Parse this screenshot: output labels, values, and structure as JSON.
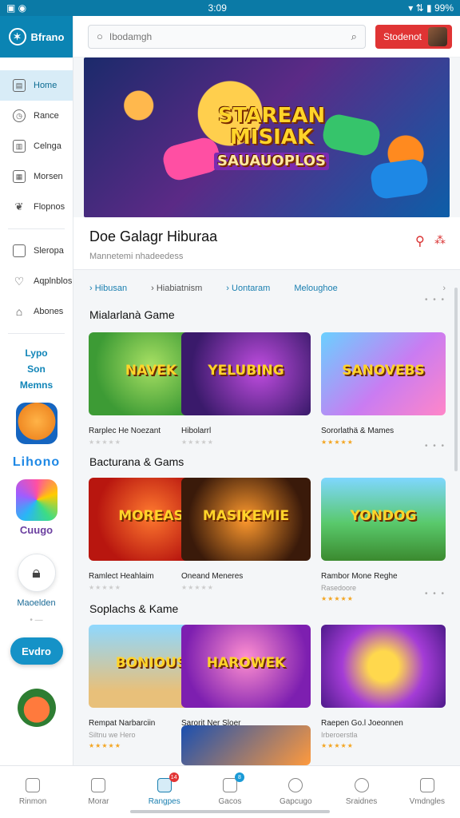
{
  "status": {
    "left_icons": "▣ ◉",
    "time": "3:09",
    "right": "▾ ⇅ ▮ 99%"
  },
  "brand": {
    "name": "Bfrano"
  },
  "sidebar": {
    "items": [
      {
        "label": "Home",
        "icon": "home-icon",
        "active": true
      },
      {
        "label": "Rance",
        "icon": "clock-icon"
      },
      {
        "label": "Celnga",
        "icon": "grid-icon"
      },
      {
        "label": "Morsen",
        "icon": "apps-icon"
      },
      {
        "label": "Flopnos",
        "icon": "leaf-icon"
      },
      {
        "label": "Sleropa",
        "icon": "square-icon"
      },
      {
        "label": "Aqplnblos",
        "icon": "heart-icon"
      },
      {
        "label": "Abones",
        "icon": "home-alt-icon"
      }
    ],
    "promo_lines": [
      "Lypo",
      "Son",
      "Memns"
    ],
    "tile_word": "Lihono",
    "tile_word2": "Cuugo",
    "lock_label": "Maoelden",
    "dots": "• —",
    "cta": "Evdro"
  },
  "search": {
    "placeholder": "Ibodamgh"
  },
  "store_button": {
    "label": "Stodenot"
  },
  "hero": {
    "line1": "STAREAN",
    "line2": "MISIAK",
    "line3": "SAUAUOPLOS",
    "title": "Doe Galagr Hiburaa",
    "subtitle": "Mannetemi nhadeedess"
  },
  "chips": [
    "Hibusan",
    "Hiabiatnism",
    "Uontaram",
    "Meloughoe"
  ],
  "sections": [
    {
      "title": "Mialarlanà Game",
      "dots": "• • •",
      "cards": [
        {
          "name": "Rarplec He Noezant",
          "thumb_word": "NAVEK",
          "stars": "★★★★★",
          "gold": false
        },
        {
          "name": "Hibolarrl",
          "thumb_word": "YELUBING",
          "stars": "★★★★★",
          "gold": false
        },
        {
          "name": "Sororlathä & Mames",
          "thumb_word": "SANOVEBS",
          "stars": "★★★★★",
          "gold": true
        }
      ]
    },
    {
      "title": "Bacturana & Gams",
      "dots": "• • •",
      "cards": [
        {
          "name": "Ramlect Heahlaim",
          "thumb_word": "MOREAS",
          "stars": "★★★★★",
          "gold": false
        },
        {
          "name": "Oneand Meneres",
          "thumb_word": "MASIKEMIE",
          "stars": "★★★★★",
          "gold": false
        },
        {
          "name": "Rambor Mone Reghe",
          "thumb_word": "YONDOG",
          "stars": "★★★★★",
          "gold": true,
          "sub": "Rasedoore"
        }
      ]
    },
    {
      "title": "Soplachs & Kame",
      "dots": "• • •",
      "cards": [
        {
          "name": "Rempat Narbarciin",
          "thumb_word": "BONIOUS",
          "stars": "★★★★★",
          "gold": true,
          "sub": "Siltnu we Hero"
        },
        {
          "name": "Sarorit Ner Sloer",
          "thumb_word": "HAROWEK",
          "stars": "★★★★★",
          "gold": true
        },
        {
          "name": "Raepen Go.l Joeonnen",
          "thumb_word": "",
          "stars": "★★★★★",
          "gold": true,
          "sub": "Irberoerstla"
        }
      ]
    }
  ],
  "bottom_nav": [
    {
      "label": "Rinmon",
      "icon": "home-icon"
    },
    {
      "label": "Morar",
      "icon": "house-icon"
    },
    {
      "label": "Rangpes",
      "icon": "gamepad-icon",
      "badge": "14",
      "active": true
    },
    {
      "label": "Gacos",
      "icon": "inbox-icon",
      "badge": "8"
    },
    {
      "label": "Gapcugo",
      "icon": "person-icon"
    },
    {
      "label": "Sraidnes",
      "icon": "people-icon"
    },
    {
      "label": "Vmdngles",
      "icon": "list-icon"
    }
  ]
}
